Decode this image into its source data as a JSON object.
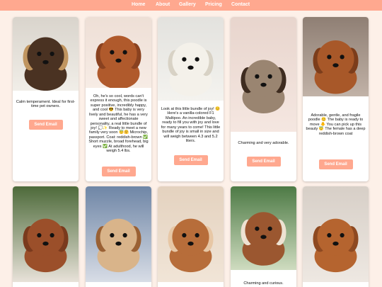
{
  "nav": [
    "Home",
    "About",
    "Gallery",
    "Pricing",
    "Contact"
  ],
  "button_label": "Send Email",
  "colors": {
    "accent": "#ffa88f",
    "background": "#fdf0e8"
  },
  "cards": [
    {
      "desc": "Calm temperament. Ideal for first-time pet owners."
    },
    {
      "desc": "Oh, he's so cool, words can't express it enough, this poodle is super positive, incredibly happy, and cool 😎 This baby is very lively and beautiful, he has a very sweet and affectionate personality, a real little bundle of joy! 💭✨ Ready to meet a new family very soon 😇🤗 Microchip, passport. Coat: reddish-brown ✅ Short muzzle, broad forehead, big eyes ✅ At adulthood, he will weigh 5.4 lbs."
    },
    {
      "desc": "Look at this little bundle of joy! 😊 Here's a vanilla-colored F1 Maltipoo. An incredible baby, ready to fill you with joy and love for many years to come! This little bundle of joy is small in size and will weigh between 4.3 and 5.2 liters."
    },
    {
      "desc": "Charming and very adorable."
    },
    {
      "desc": "Adorable, gentle, and fragile poodle 😊 The baby is ready to move 🐥 You can pick up this beauty 😇 The female has a deep reddish-brown coat"
    },
    {
      "desc": ""
    },
    {
      "desc": ""
    },
    {
      "desc": ""
    },
    {
      "desc": "Charming and curious."
    },
    {
      "desc": ""
    }
  ]
}
